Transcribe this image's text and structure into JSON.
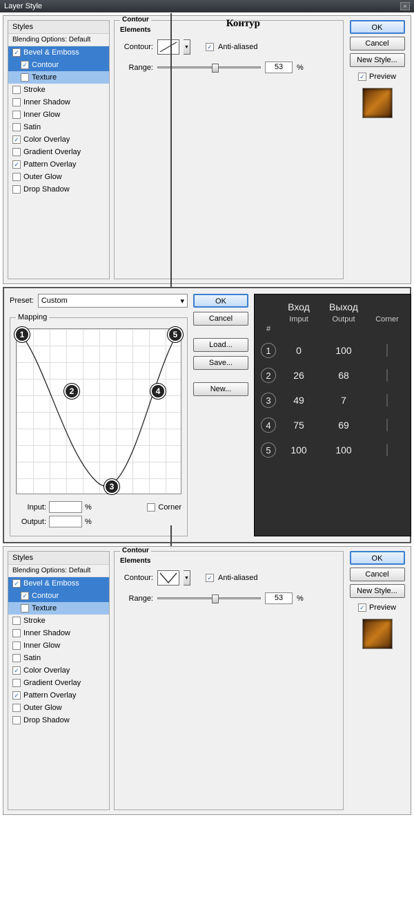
{
  "title": "Layer Style",
  "annotation_top": "Контур",
  "styles": {
    "header": "Styles",
    "blending": "Blending Options: Default",
    "items": [
      {
        "label": "Bevel & Emboss",
        "checked": true,
        "selected": true
      },
      {
        "label": "Contour",
        "checked": true,
        "sub": true,
        "selected": true
      },
      {
        "label": "Texture",
        "checked": false,
        "sub": true
      },
      {
        "label": "Stroke",
        "checked": false
      },
      {
        "label": "Inner Shadow",
        "checked": false
      },
      {
        "label": "Inner Glow",
        "checked": false
      },
      {
        "label": "Satin",
        "checked": false
      },
      {
        "label": "Color Overlay",
        "checked": true
      },
      {
        "label": "Gradient Overlay",
        "checked": false
      },
      {
        "label": "Pattern Overlay",
        "checked": true
      },
      {
        "label": "Outer Glow",
        "checked": false
      },
      {
        "label": "Drop Shadow",
        "checked": false
      }
    ]
  },
  "contour_panel": {
    "legend": "Contour",
    "elements_label": "Elements",
    "contour_label": "Contour:",
    "anti_aliased": "Anti-aliased",
    "range_label": "Range:",
    "range_value": "53",
    "range_pct": "%"
  },
  "buttons": {
    "ok": "OK",
    "cancel": "Cancel",
    "new_style": "New Style...",
    "preview": "Preview"
  },
  "editor": {
    "preset_label": "Preset:",
    "preset_value": "Custom",
    "mapping_legend": "Mapping",
    "input_label": "Input:",
    "output_label": "Output:",
    "pct": "%",
    "corner": "Corner",
    "buttons": {
      "ok": "OK",
      "cancel": "Cancel",
      "load": "Load...",
      "save": "Save...",
      "new": "New..."
    },
    "markers": [
      {
        "n": "1",
        "x": 0,
        "y": 100
      },
      {
        "n": "2",
        "x": 26,
        "y": 68
      },
      {
        "n": "3",
        "x": 49,
        "y": 7
      },
      {
        "n": "4",
        "x": 75,
        "y": 69
      },
      {
        "n": "5",
        "x": 100,
        "y": 100
      }
    ]
  },
  "table": {
    "head_input_ru": "Вход",
    "head_output_ru": "Выход",
    "head_hash": "#",
    "head_input": "Imput",
    "head_output": "Output",
    "head_corner": "Corner",
    "rows": [
      {
        "n": "1",
        "in": "0",
        "out": "100"
      },
      {
        "n": "2",
        "in": "26",
        "out": "68"
      },
      {
        "n": "3",
        "in": "49",
        "out": "7"
      },
      {
        "n": "4",
        "in": "75",
        "out": "69"
      },
      {
        "n": "5",
        "in": "100",
        "out": "100"
      }
    ]
  },
  "chart_data": {
    "type": "line",
    "title": "Contour Mapping Curve",
    "xlabel": "Input",
    "ylabel": "Output",
    "xlim": [
      0,
      100
    ],
    "ylim": [
      0,
      100
    ],
    "x": [
      0,
      26,
      49,
      75,
      100
    ],
    "y": [
      100,
      68,
      7,
      69,
      100
    ]
  }
}
